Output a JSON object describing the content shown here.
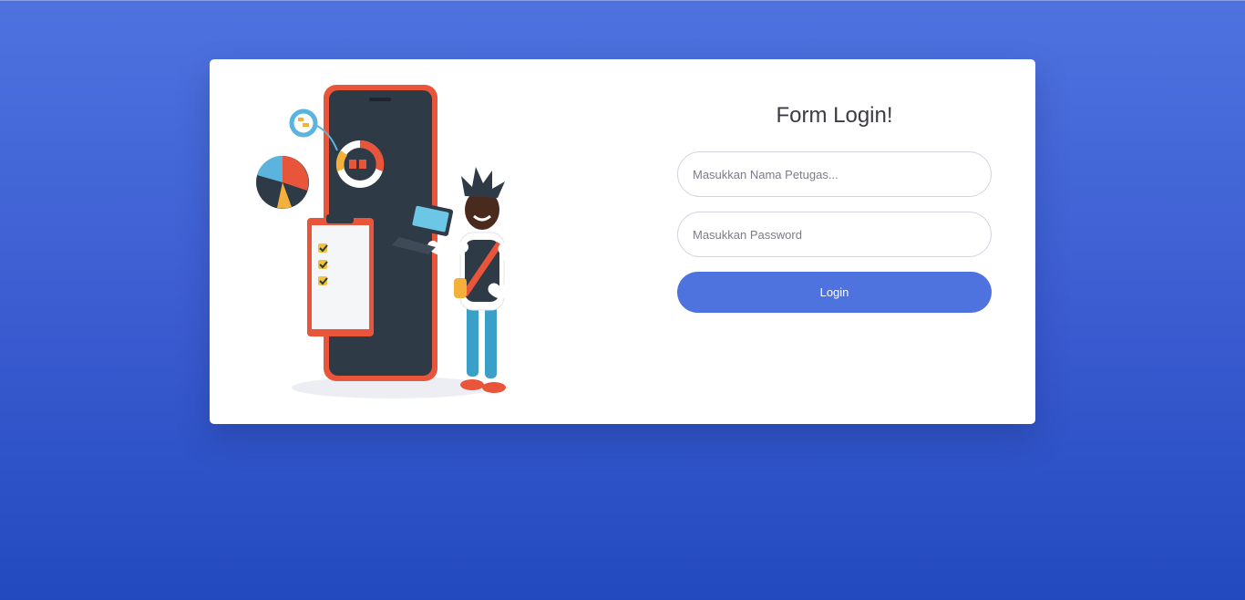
{
  "login_form": {
    "title": "Form Login!",
    "username_placeholder": "Masukkan Nama Petugas...",
    "password_placeholder": "Masukkan Password",
    "login_label": "Login"
  },
  "colors": {
    "background_top": "#4e73df",
    "background_bottom": "#224abe",
    "card": "#ffffff",
    "button": "#4e73df",
    "title_text": "#3a3b45"
  },
  "illustration": {
    "icon": "analytics-person-phone-illustration"
  }
}
